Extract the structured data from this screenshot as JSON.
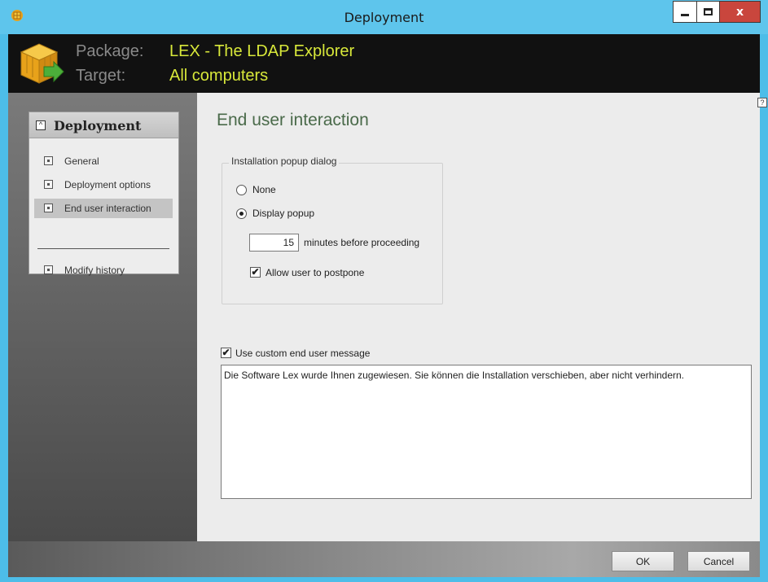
{
  "window": {
    "title": "Deployment",
    "close_glyph": "x"
  },
  "header": {
    "package_label": "Package:",
    "package_value": "LEX - The LDAP Explorer",
    "target_label": "Target:",
    "target_value": "All computers",
    "value_color": "#d8e83a"
  },
  "nav": {
    "collapse_glyph": "^",
    "title": "Deployment",
    "items": [
      {
        "label": "General",
        "selected": false
      },
      {
        "label": "Deployment options",
        "selected": false
      },
      {
        "label": "End user interaction",
        "selected": true
      },
      {
        "label": "Modify history",
        "selected": false
      }
    ]
  },
  "content": {
    "help_glyph": "?",
    "section_title": "End user interaction",
    "popup_group": {
      "legend": "Installation popup dialog",
      "options": [
        {
          "label": "None",
          "checked": false
        },
        {
          "label": "Display popup",
          "checked": true
        }
      ],
      "minutes_value": "15",
      "minutes_label": "minutes before proceeding",
      "postpone_label": "Allow user to postpone",
      "postpone_checked": true
    },
    "custom_message": {
      "label": "Use custom end user message",
      "checked": true,
      "text": "Die Software Lex wurde Ihnen zugewiesen. Sie können die Installation verschieben, aber nicht verhindern."
    }
  },
  "footer": {
    "ok_label": "OK",
    "cancel_label": "Cancel"
  },
  "icons": {
    "app_icon": "package-cube-icon",
    "banner_icon": "package-deploy-icon",
    "check_glyph": "✔"
  }
}
